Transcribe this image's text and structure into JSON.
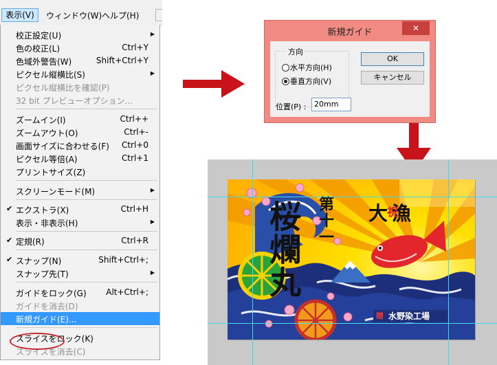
{
  "menubar": {
    "items": [
      "表示(V)",
      "ウィンドウ(W)",
      "ヘルプ(H)"
    ]
  },
  "menu": {
    "items": [
      {
        "label": "校正設定(U)",
        "shortcut": "",
        "submenu": true,
        "disabled": false,
        "checked": false
      },
      {
        "label": "色の校正(L)",
        "shortcut": "Ctrl+Y",
        "submenu": false,
        "disabled": false,
        "checked": false
      },
      {
        "label": "色域外警告(W)",
        "shortcut": "Shift+Ctrl+Y",
        "submenu": false,
        "disabled": false,
        "checked": false
      },
      {
        "label": "ピクセル縦横比(S)",
        "shortcut": "",
        "submenu": true,
        "disabled": false,
        "checked": false
      },
      {
        "label": "ピクセル縦横比を確認(P)",
        "shortcut": "",
        "submenu": false,
        "disabled": true,
        "checked": false
      },
      {
        "label": "32 bit プレビューオプション...",
        "shortcut": "",
        "submenu": false,
        "disabled": true,
        "checked": false
      },
      {
        "label": "ズームイン(I)",
        "shortcut": "Ctrl++",
        "submenu": false,
        "disabled": false,
        "checked": false
      },
      {
        "label": "ズームアウト(O)",
        "shortcut": "Ctrl+-",
        "submenu": false,
        "disabled": false,
        "checked": false
      },
      {
        "label": "画面サイズに合わせる(F)",
        "shortcut": "Ctrl+0",
        "submenu": false,
        "disabled": false,
        "checked": false
      },
      {
        "label": "ピクセル等倍(A)",
        "shortcut": "Ctrl+1",
        "submenu": false,
        "disabled": false,
        "checked": false
      },
      {
        "label": "プリントサイズ(Z)",
        "shortcut": "",
        "submenu": false,
        "disabled": false,
        "checked": false
      },
      {
        "label": "スクリーンモード(M)",
        "shortcut": "",
        "submenu": true,
        "disabled": false,
        "checked": false
      },
      {
        "label": "エクストラ(X)",
        "shortcut": "Ctrl+H",
        "submenu": false,
        "disabled": false,
        "checked": true
      },
      {
        "label": "表示・非表示(H)",
        "shortcut": "",
        "submenu": true,
        "disabled": false,
        "checked": false
      },
      {
        "label": "定規(R)",
        "shortcut": "Ctrl+R",
        "submenu": false,
        "disabled": false,
        "checked": true
      },
      {
        "label": "スナップ(N)",
        "shortcut": "Shift+Ctrl+;",
        "submenu": false,
        "disabled": false,
        "checked": true
      },
      {
        "label": "スナップ先(T)",
        "shortcut": "",
        "submenu": true,
        "disabled": false,
        "checked": false
      },
      {
        "label": "ガイドをロック(G)",
        "shortcut": "Alt+Ctrl+;",
        "submenu": false,
        "disabled": false,
        "checked": false
      },
      {
        "label": "ガイドを消去(D)",
        "shortcut": "",
        "submenu": false,
        "disabled": true,
        "checked": false
      },
      {
        "label": "新規ガイド(E)...",
        "shortcut": "",
        "submenu": false,
        "disabled": false,
        "checked": false,
        "highlighted": true
      },
      {
        "label": "スライスをロック(K)",
        "shortcut": "",
        "submenu": false,
        "disabled": false,
        "checked": false
      },
      {
        "label": "スライスを消去(C)",
        "shortcut": "",
        "submenu": false,
        "disabled": true,
        "checked": false
      }
    ]
  },
  "dialog": {
    "title": "新規ガイド",
    "close": "✕",
    "group_label": "方向",
    "horizontal": "水平方向(H)",
    "vertical": "垂直方向(V)",
    "ok": "OK",
    "cancel": "キャンセル",
    "position_label": "位置(P) :",
    "position_value": "20mm",
    "selected_orientation": "vertical"
  },
  "artwork": {
    "title": "桜爛丸",
    "prefix": "第十一",
    "slogan": "大漁",
    "slogan_mark": "祝",
    "maker_mark": "贈",
    "maker": "水野染工場"
  },
  "colors": {
    "arrow": "#c8131a",
    "dialog_title_bar": "#f08a82",
    "close_button": "#c7403c",
    "menu_highlight": "#3399ff",
    "guide": "#44d9ea",
    "canvas_bg": "#c9c9c9"
  }
}
